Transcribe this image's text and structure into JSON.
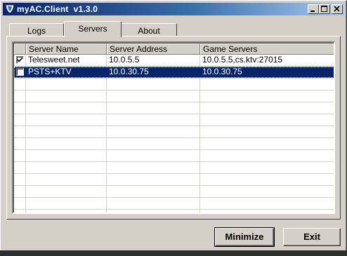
{
  "window": {
    "title": "myAC.Client  v1.3.0",
    "icon": "app-shield-icon",
    "controls": [
      "minimize-icon",
      "maximize-icon",
      "close-icon"
    ]
  },
  "tabs": [
    {
      "label": "Logs",
      "active": false
    },
    {
      "label": "Servers",
      "active": true
    },
    {
      "label": "About",
      "active": false
    }
  ],
  "servers_table": {
    "columns": [
      "",
      "Server Name",
      "Server Address",
      "Game Servers"
    ],
    "rows": [
      {
        "checked": true,
        "name": "Telesweet.net",
        "address": "10.0.5.5",
        "game_servers": "10.0.5.5,cs.ktv:27015",
        "selected": false
      },
      {
        "checked": false,
        "name": "PSTS+KTV",
        "address": "10.0.30.75",
        "game_servers": "10.0.30.75",
        "selected": true
      }
    ]
  },
  "buttons": {
    "minimize_label": "Minimize",
    "exit_label": "Exit"
  },
  "colors": {
    "titlebar_start": "#0a246a",
    "titlebar_end": "#a6caf0",
    "selection": "#0a246a",
    "face": "#d4d0c8"
  }
}
